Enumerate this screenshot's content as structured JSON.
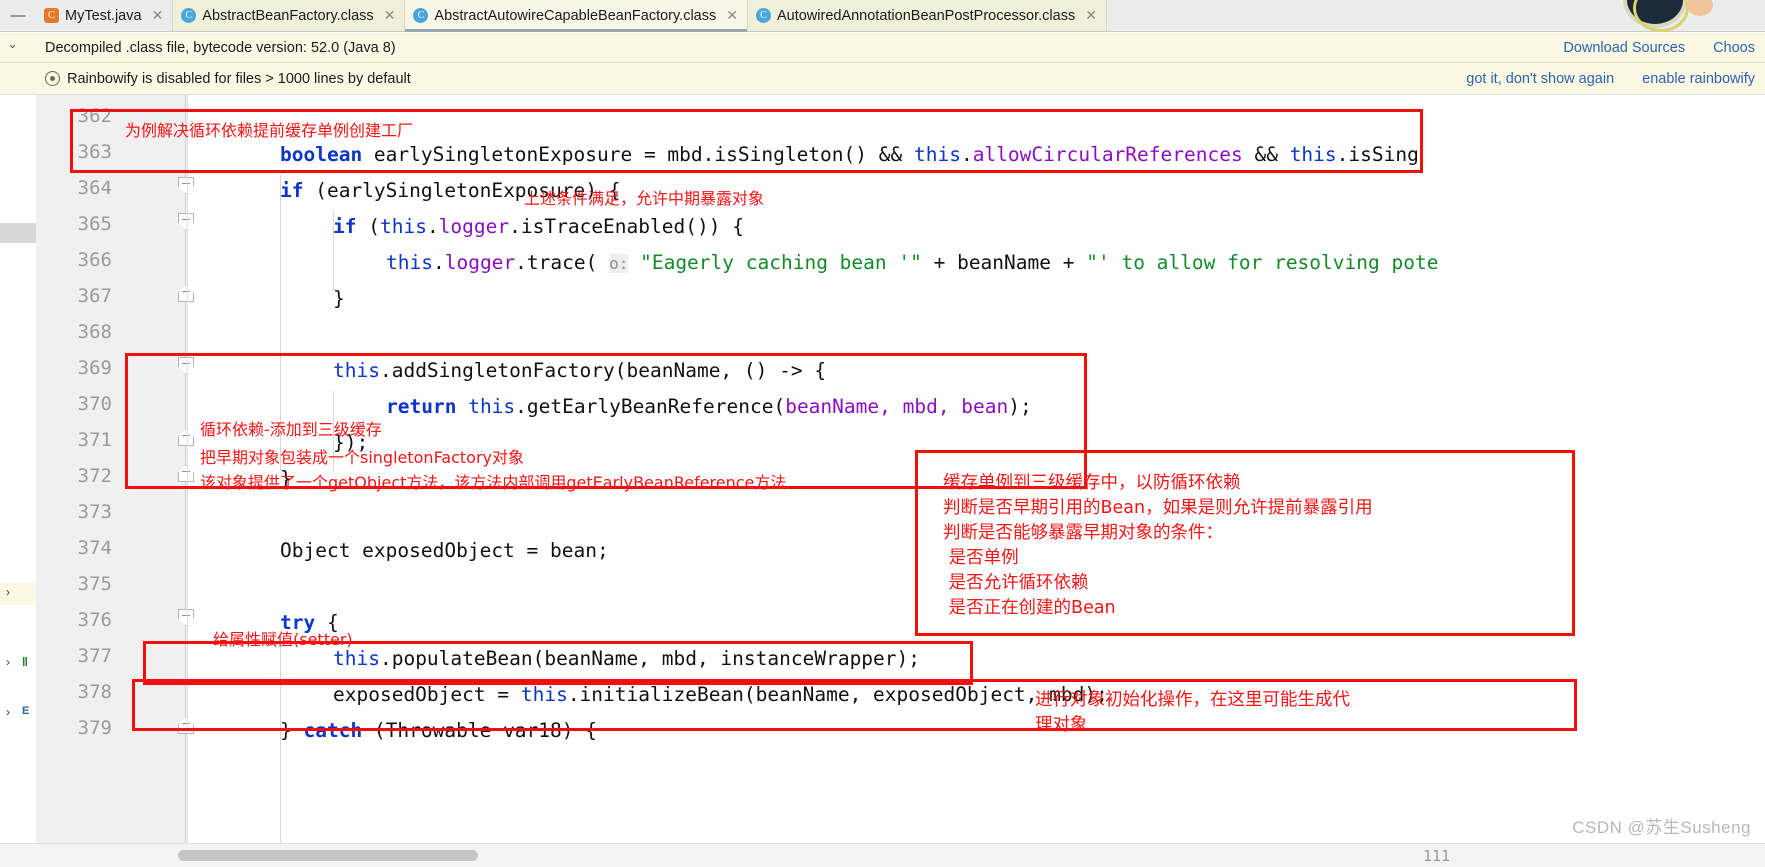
{
  "window": {
    "tabs": [
      {
        "label": "MyTest.java",
        "icon": "java-class-icon",
        "state": "inactive",
        "closable": true
      },
      {
        "label": "AbstractBeanFactory.class",
        "icon": "class-file-icon",
        "state": "inactive",
        "closable": true
      },
      {
        "label": "AbstractAutowireCapableBeanFactory.class",
        "icon": "class-file-icon",
        "state": "selected",
        "closable": true
      },
      {
        "label": "AutowiredAnnotationBeanPostProcessor.class",
        "icon": "class-file-icon",
        "state": "inactive",
        "closable": true
      }
    ],
    "collapse_glyph": "—"
  },
  "banners": {
    "decompiled": {
      "message": "Decompiled .class file, bytecode version: 52.0 (Java 8)",
      "actions": [
        "Download Sources",
        "Choos"
      ]
    },
    "rainbowify": {
      "icon": "eye-icon",
      "message": "Rainbowify is disabled for files > 1000 lines by default",
      "actions": [
        "got it, don't show again",
        "enable rainbowify"
      ]
    }
  },
  "gutter": {
    "line_numbers": [
      "362",
      "363",
      "364",
      "365",
      "366",
      "367",
      "368",
      "369",
      "370",
      "371",
      "372",
      "373",
      "374",
      "375",
      "376",
      "377",
      "378",
      "379"
    ]
  },
  "code": {
    "lines": [
      {
        "num": "362",
        "segments": []
      },
      {
        "num": "363",
        "segments": [
          {
            "t": "boolean",
            "c": "kw"
          },
          {
            "t": " earlySingletonExposure = mbd.isSingleton() && ",
            "c": "plain"
          },
          {
            "t": "this",
            "c": "kw2"
          },
          {
            "t": ".",
            "c": "plain"
          },
          {
            "t": "allowCircularReferences",
            "c": "fld"
          },
          {
            "t": " && ",
            "c": "plain"
          },
          {
            "t": "this",
            "c": "kw2"
          },
          {
            "t": ".isSing",
            "c": "plain"
          }
        ]
      },
      {
        "num": "364",
        "segments": [
          {
            "t": "if",
            "c": "kw"
          },
          {
            "t": " (earlySingletonExposure) {",
            "c": "plain"
          }
        ]
      },
      {
        "num": "365",
        "segments": [
          {
            "t": "    if",
            "c": "kw"
          },
          {
            "t": " (",
            "c": "plain"
          },
          {
            "t": "this",
            "c": "kw2"
          },
          {
            "t": ".",
            "c": "plain"
          },
          {
            "t": "logger",
            "c": "fld"
          },
          {
            "t": ".isTraceEnabled()) {",
            "c": "plain"
          }
        ]
      },
      {
        "num": "366",
        "segments": [
          {
            "t": "        this",
            "c": "kw2"
          },
          {
            "t": ".",
            "c": "plain"
          },
          {
            "t": "logger",
            "c": "fld"
          },
          {
            "t": ".trace( ",
            "c": "plain"
          },
          {
            "t": "o:",
            "c": "param"
          },
          {
            "t": " \"Eagerly caching bean '\"",
            "c": "str"
          },
          {
            "t": " + beanName + ",
            "c": "plain"
          },
          {
            "t": "\"' to allow for resolving pote",
            "c": "str"
          }
        ]
      },
      {
        "num": "367",
        "segments": [
          {
            "t": "    }",
            "c": "plain"
          }
        ]
      },
      {
        "num": "368",
        "segments": []
      },
      {
        "num": "369",
        "segments": [
          {
            "t": "    this",
            "c": "kw2"
          },
          {
            "t": ".addSingletonFactory(beanName, () -> {",
            "c": "plain"
          }
        ]
      },
      {
        "num": "370",
        "segments": [
          {
            "t": "        return",
            "c": "kw"
          },
          {
            "t": " ",
            "c": "plain"
          },
          {
            "t": "this",
            "c": "kw2"
          },
          {
            "t": ".getEarlyBeanReference(",
            "c": "plain"
          },
          {
            "t": "beanName, mbd, bean",
            "c": "fld"
          },
          {
            "t": ");",
            "c": "plain"
          }
        ]
      },
      {
        "num": "371",
        "segments": [
          {
            "t": "    });",
            "c": "plain"
          }
        ]
      },
      {
        "num": "372",
        "segments": [
          {
            "t": "}",
            "c": "plain"
          }
        ]
      },
      {
        "num": "373",
        "segments": []
      },
      {
        "num": "374",
        "segments": [
          {
            "t": "Object exposedObject = bean;",
            "c": "plain"
          }
        ]
      },
      {
        "num": "375",
        "segments": []
      },
      {
        "num": "376",
        "segments": [
          {
            "t": "try",
            "c": "kw"
          },
          {
            "t": " {",
            "c": "plain"
          }
        ]
      },
      {
        "num": "377",
        "segments": [
          {
            "t": "    this",
            "c": "kw2"
          },
          {
            "t": ".populateBean(beanName, mbd, instanceWrapper);",
            "c": "plain"
          }
        ]
      },
      {
        "num": "378",
        "segments": [
          {
            "t": "    exposedObject = ",
            "c": "plain"
          },
          {
            "t": "this",
            "c": "kw2"
          },
          {
            "t": ".initializeBean(beanName, exposedObject, mbd);",
            "c": "plain"
          }
        ]
      },
      {
        "num": "379",
        "segments": [
          {
            "t": "} ",
            "c": "plain"
          },
          {
            "t": "catch",
            "c": "kw"
          },
          {
            "t": " (Throwable var18) {",
            "c": "plain"
          }
        ]
      }
    ]
  },
  "annotations": {
    "a1": "为例解决循环依赖提前缓存单例创建工厂",
    "a2": "上述条件满足，允许中期暴露对象",
    "a3": "循环依赖-添加到三级缓存",
    "a4": "把早期对象包装成一个singletonFactory对象",
    "a5": "该对象提供了一个getObject方法，该方法内部调用getEarlyBeanReference方法",
    "a6_line1": "缓存单例到三级缓存中，以防循环依赖",
    "a6_line2": "判断是否早期引用的Bean，如果是则允许提前暴露引用",
    "a6_line3": "判断是否能够暴露早期对象的条件：",
    "a6_line4": " 是否单例",
    "a6_line5": " 是否允许循环依赖",
    "a6_line6": " 是否正在创建的Bean",
    "a7": "给属性赋值(setter)",
    "a8_line1": "进行对象初始化操作，在这里可能生成代",
    "a8_line2": "理对象"
  },
  "watermark": "CSDN @苏生Susheng",
  "scrollbar": {
    "tick_label": "111"
  },
  "colors": {
    "annotation_red": "#f71414",
    "box_red": "#f40f0f",
    "banner_bg": "#fbf8e3",
    "link_blue": "#2b63b0",
    "keyword_blue": "#0d35c7",
    "field_purple": "#8a0fc4",
    "string_green": "#128b28",
    "gutter_bg": "#f0f0f0"
  }
}
